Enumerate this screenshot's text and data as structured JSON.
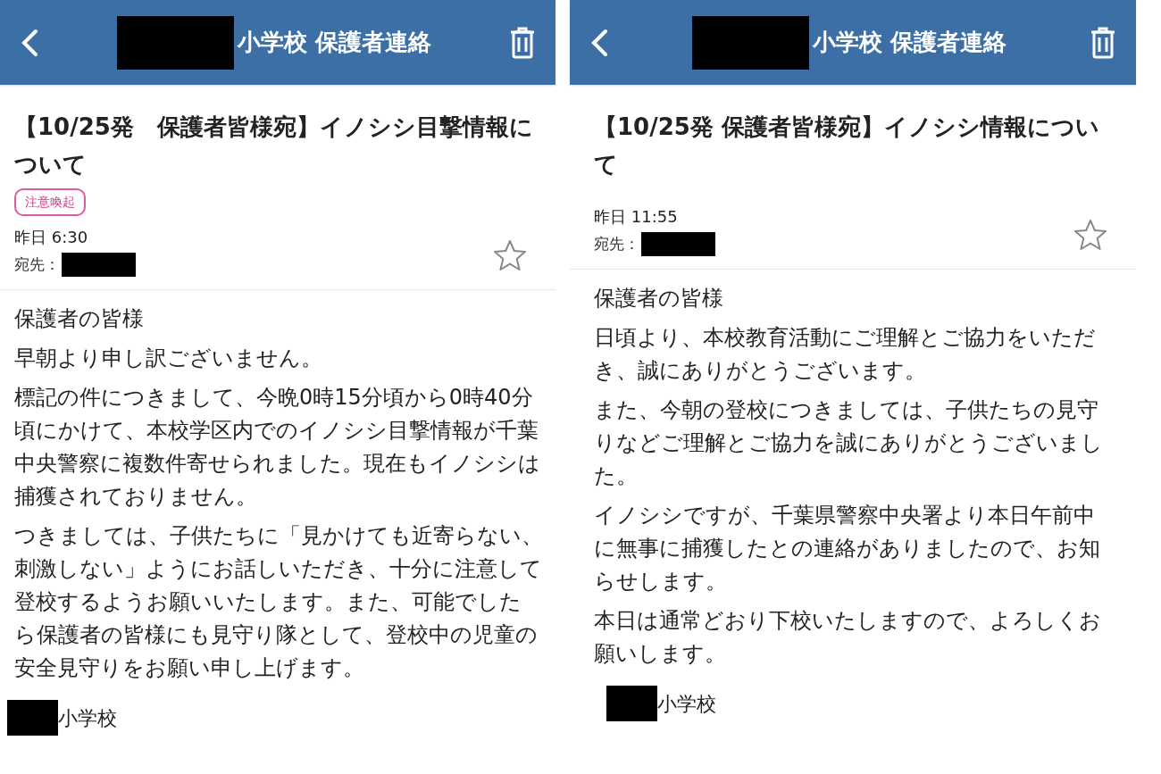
{
  "panels": [
    {
      "header": {
        "title": "小学校 保護者連絡"
      },
      "message": {
        "title": "【10/25発　保護者皆様宛】イノシシ目撃情報について",
        "tag": "注意喚起",
        "date": "昨日 6:30",
        "recipient_label": "宛先：",
        "starred": false,
        "body": [
          "保護者の皆様",
          "早朝より申し訳ございません。",
          "標記の件につきまして、今晩0時15分頃から0時40分頃にかけて、本校学区内でのイノシシ目撃情報が千葉中央警察に複数件寄せられました。現在もイノシシは捕獲されておりません。",
          "つきましては、子供たちに「見かけても近寄らない、刺激しない」ようにお話しいただき、十分に注意して登校するようお願いいたします。また、可能でしたら保護者の皆様にも見守り隊として、登校中の児童の安全見守りをお願い申し上げます。"
        ],
        "signature": "小学校"
      }
    },
    {
      "header": {
        "title": "小学校 保護者連絡"
      },
      "message": {
        "title": "【10/25発 保護者皆様宛】イノシシ情報について",
        "date": "昨日 11:55",
        "recipient_label": "宛先：",
        "starred": false,
        "body": [
          "保護者の皆様",
          "日頃より、本校教育活動にご理解とご協力をいただき、誠にありがとうございます。",
          "また、今朝の登校につきましては、子供たちの見守りなどご理解とご協力を誠にありがとうございました。",
          "イノシシですが、千葉県警察中央署より本日午前中に無事に捕獲したとの連絡がありましたので、お知らせします。",
          "本日は通常どおり下校いたしますので、よろしくお願いします。"
        ],
        "signature": "小学校"
      }
    }
  ]
}
